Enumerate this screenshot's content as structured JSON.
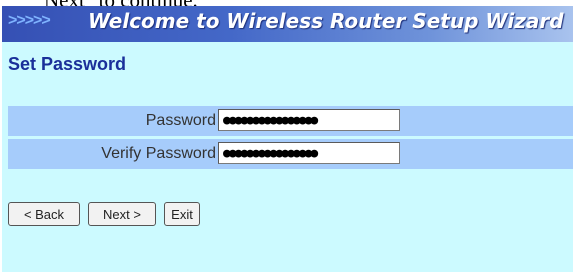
{
  "caption": {
    "text": "Next\" to continue."
  },
  "banner": {
    "arrows": ">>>>>",
    "title": "Welcome to Wireless Router Setup Wizard"
  },
  "section": {
    "title": "Set Password"
  },
  "form": {
    "password_label": "Password",
    "password_value": "●●●●●●●●●●●●●●●●",
    "verify_label": "Verify Password",
    "verify_value": "●●●●●●●●●●●●●●●●"
  },
  "buttons": {
    "back_label": "< Back",
    "next_label": "Next >",
    "exit_label": "Exit"
  },
  "colors": {
    "panel_background": "#ccfaff",
    "row_background": "#a6ccfb",
    "banner_start": "#3550b4",
    "banner_end": "#a9c3ee",
    "section_title": "#1a2f9a"
  }
}
